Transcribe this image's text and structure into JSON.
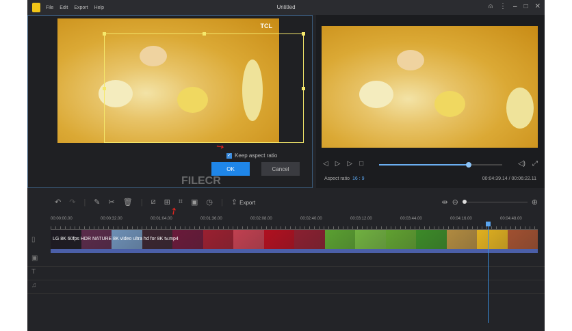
{
  "titlebar": {
    "menus": [
      "File",
      "Edit",
      "Export",
      "Help"
    ],
    "title": "Untitled"
  },
  "crop": {
    "brand": "TCL",
    "keep_aspect_label": "Keep aspect ratio",
    "keep_aspect_checked": true,
    "ok": "OK",
    "cancel": "Cancel"
  },
  "preview": {
    "aspect_label": "Aspect ratio",
    "aspect_value": "16 : 9",
    "time": "00:04:39.14 / 00:06:22.11",
    "progress": 0.73
  },
  "toolbar": {
    "export": "Export"
  },
  "watermark": "FILECR",
  "ruler": [
    "00:00:00.00",
    "00:00:32.00",
    "00:01:04.00",
    "00:01:36.00",
    "00:02:08.00",
    "00:02:40.00",
    "00:03:12.00",
    "00:03:44.00",
    "00:04:16.00",
    "00:04:48.00"
  ],
  "clip": {
    "label": "LG 8K 60fps HDR NATURE 8K video ultra hd for 8K tv.mp4",
    "colors": [
      "#1d1a22",
      "#5a2a4a",
      "#6d8fb5",
      "#3a2530",
      "#6a1a3a",
      "#9a2030",
      "#c04050",
      "#b01020",
      "#8a2030",
      "#5aa030",
      "#70b040",
      "#60a030",
      "#3c8a28",
      "#b08a40",
      "#e0b020",
      "#a05030"
    ]
  }
}
